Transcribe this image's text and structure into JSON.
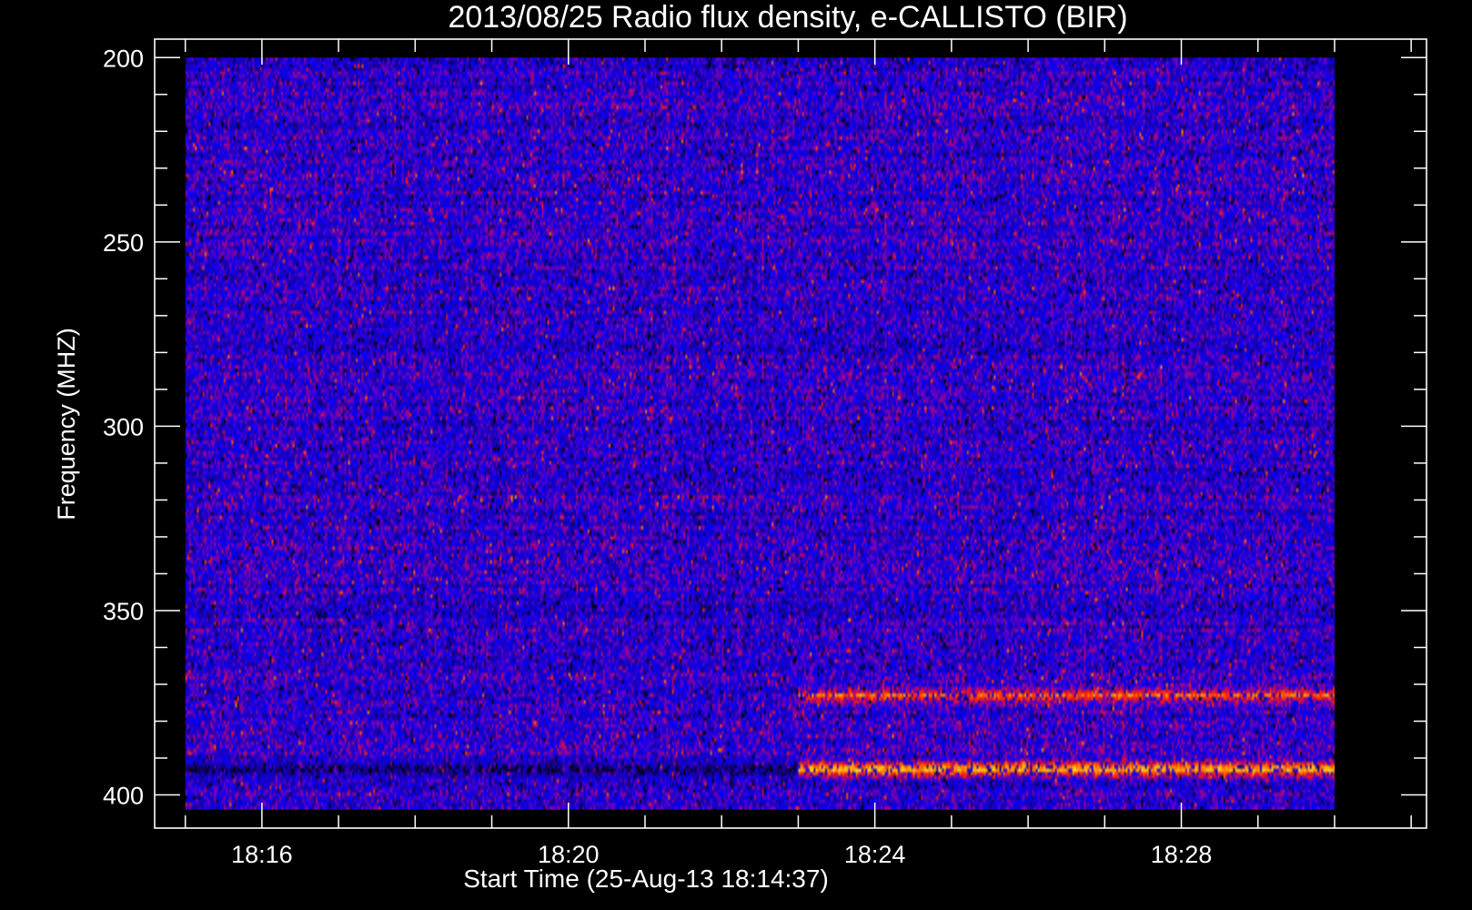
{
  "chart_data": {
    "type": "heatmap",
    "title": "2013/08/25  Radio flux density, e-CALLISTO (BIR)",
    "xlabel": "Start Time (25-Aug-13 18:14:37)",
    "ylabel": "Frequency (MHZ)",
    "x_start": "18:15:00",
    "x_end": "18:30:00",
    "x_range_minutes": [
      14.6,
      31.2
    ],
    "y_range_mhz": [
      195,
      409
    ],
    "y_inverted": true,
    "x_ticks": [
      {
        "minute": 16,
        "label": "18:16"
      },
      {
        "minute": 20,
        "label": "18:20"
      },
      {
        "minute": 24,
        "label": "18:24"
      },
      {
        "minute": 28,
        "label": "18:28"
      }
    ],
    "x_minor_step_minutes": 1,
    "y_ticks": [
      {
        "mhz": 200,
        "label": "200"
      },
      {
        "mhz": 250,
        "label": "250"
      },
      {
        "mhz": 300,
        "label": "300"
      },
      {
        "mhz": 350,
        "label": "350"
      },
      {
        "mhz": 400,
        "label": "400"
      }
    ],
    "y_minor_step_mhz": 10,
    "data_extent": {
      "time": [
        "18:15:00",
        "18:30:00"
      ],
      "freq_mhz": [
        200,
        404
      ]
    },
    "colormap": [
      "#000000",
      "#1e00b4",
      "#0000ff",
      "#8c00a0",
      "#ff2000",
      "#ffb000",
      "#ffff60"
    ],
    "background_level": 0.32,
    "features": [
      {
        "name": "interference band",
        "freq_mhz": 393,
        "time_start": "18:23:00",
        "time_end": "18:30:00",
        "level": 0.9
      },
      {
        "name": "interference band",
        "freq_mhz": 373,
        "time_start": "18:23:00",
        "time_end": "18:30:00",
        "level": 0.75
      },
      {
        "name": "low intensity band",
        "freq_mhz": 393,
        "time_start": "18:15:00",
        "time_end": "18:23:00",
        "level": 0.05
      }
    ],
    "grid": false,
    "legend": "none"
  }
}
